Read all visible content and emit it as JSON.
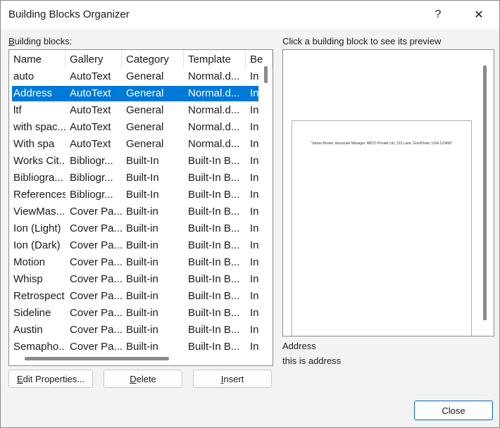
{
  "window": {
    "title": "Building Blocks Organizer",
    "help_glyph": "?",
    "close_glyph": "✕"
  },
  "list": {
    "label_accel": "B",
    "label_rest": "uilding blocks:",
    "columns": [
      "Name",
      "Gallery",
      "Category",
      "Template",
      "Be"
    ],
    "selected_index": 1,
    "rows": [
      [
        "auto",
        "AutoText",
        "General",
        "Normal.d...",
        "In"
      ],
      [
        "Address",
        "AutoText",
        "General",
        "Normal.d...",
        "In"
      ],
      [
        "ltf",
        "AutoText",
        "General",
        "Normal.d...",
        "In"
      ],
      [
        "with spac...",
        "AutoText",
        "General",
        "Normal.d...",
        "In"
      ],
      [
        "With spa",
        "AutoText",
        "General",
        "Normal.d...",
        "In"
      ],
      [
        "Works Cit...",
        "Bibliogr...",
        "Built-In",
        "Built-In B...",
        "In"
      ],
      [
        "Bibliogra...",
        "Bibliogr...",
        "Built-In",
        "Built-In B...",
        "In"
      ],
      [
        "References",
        "Bibliogr...",
        "Built-In",
        "Built-In B...",
        "In"
      ],
      [
        "ViewMas...",
        "Cover Pa...",
        "Built-in",
        "Built-In B...",
        "In"
      ],
      [
        "Ion (Light)",
        "Cover Pa...",
        "Built-in",
        "Built-In B...",
        "In"
      ],
      [
        "Ion (Dark)",
        "Cover Pa...",
        "Built-in",
        "Built-In B...",
        "In"
      ],
      [
        "Motion",
        "Cover Pa...",
        "Built-in",
        "Built-In B...",
        "In"
      ],
      [
        "Whisp",
        "Cover Pa...",
        "Built-in",
        "Built-In B...",
        "In"
      ],
      [
        "Retrospect",
        "Cover Pa...",
        "Built-in",
        "Built-In B...",
        "In"
      ],
      [
        "Sideline",
        "Cover Pa...",
        "Built-in",
        "Built-In B...",
        "In"
      ],
      [
        "Austin",
        "Cover Pa...",
        "Built-in",
        "Built-In B...",
        "In"
      ],
      [
        "Semapho...",
        "Cover Pa...",
        "Built-in",
        "Built-In B...",
        "In"
      ]
    ]
  },
  "buttons": {
    "edit_accel": "E",
    "edit_rest": "dit Properties...",
    "delete_accel": "D",
    "delete_rest": "elete",
    "insert_accel": "I",
    "insert_rest": "nsert",
    "close": "Close"
  },
  "preview": {
    "label": "Click a building block to see its preview",
    "text": "\"James Brown, Associate Manager, ABCD Private Ltd, 123 Lane, GoodTown, USA 123456\"",
    "name": "Address",
    "description": "this is address"
  },
  "colors": {
    "selection": "#0078d7",
    "accent_border": "#0067c0"
  }
}
